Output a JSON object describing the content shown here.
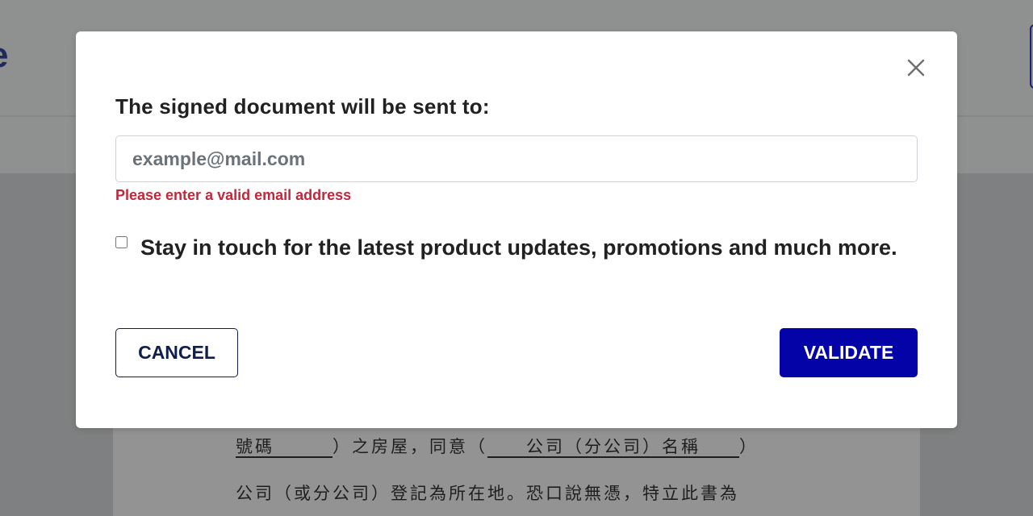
{
  "background": {
    "logo_fragment": "e",
    "document_lines": {
      "line1": {
        "field_number": "號碼　　　",
        "text_a": "）之房屋，同意（",
        "field_company": "　　公司（分公司）名稱　　",
        "text_b": "）"
      },
      "line2": "公司（或分公司）登記為所在地。恐口說無憑，特立此書為"
    }
  },
  "modal": {
    "title": "The signed document will be sent to:",
    "close_icon": "close-icon",
    "email": {
      "value": "",
      "placeholder": "example@mail.com"
    },
    "error": "Please enter a valid email address",
    "newsletter": {
      "checked": false,
      "label": "Stay in touch for the latest product updates, promotions and much more."
    },
    "buttons": {
      "cancel": "CANCEL",
      "validate": "VALIDATE"
    }
  },
  "colors": {
    "primary": "#0303a8",
    "error": "#c0283c",
    "cancel_border": "#0f1e4a",
    "overlay": "#8e8f8f"
  }
}
